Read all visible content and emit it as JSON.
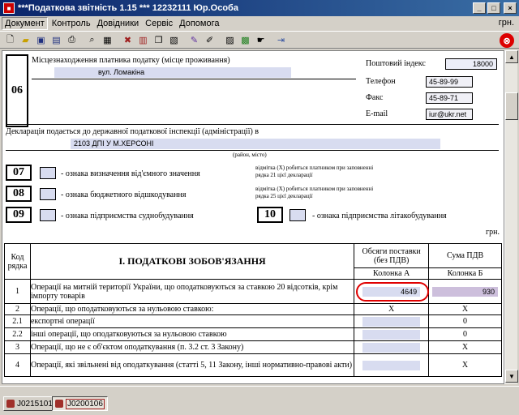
{
  "window": {
    "title": "***Податкова звітність 1.15 *** 12232111 Юр.Особа"
  },
  "menu": {
    "items": [
      "Документ",
      "Контроль",
      "Довідники",
      "Сервіс",
      "Допомога"
    ],
    "currency": "грн."
  },
  "toolbar": {
    "icons": [
      "new-icon",
      "open-icon",
      "save-icon",
      "save-all-icon",
      "print-icon",
      "print-preview-icon",
      "report-icon",
      "delete-icon",
      "books-icon",
      "copy-icon",
      "paste-icon",
      "check-icon",
      "edit-icon",
      "calc-icon",
      "form-icon",
      "lookup-icon",
      "export-icon",
      "exit-icon"
    ]
  },
  "doc": {
    "section06": {
      "num": "06",
      "label": "Місцезнаходження платника податку (місце проживання)",
      "street": "вул. Ломакіна",
      "postal_label": "Поштовий індекс",
      "postal": "18000",
      "phone_label": "Телефон",
      "phone": "45-89-99",
      "fax_label": "Факс",
      "fax": "45-89-71",
      "email_label": "E-mail",
      "email": "iur@ukr.net"
    },
    "declaration_label": "Декларація подається до державної податкової інспекції (адміністрації) в",
    "inspection": "2103 ДПІ У М.ХЕРСОНІ",
    "district_hint": "(район, місто)",
    "flag07": {
      "num": "07",
      "label": "- ознака визначення від'ємного значення",
      "note": "відмітка (Х) робиться платником при заповненні рядка 21 цієї декларації"
    },
    "flag08": {
      "num": "08",
      "label": "- ознака бюджетного відшкодування",
      "note": "відмітка (Х) робиться платником при заповненні рядка 25 цієї декларації"
    },
    "flag09": {
      "num": "09",
      "label": "- ознака підприємства суднобудування"
    },
    "flag10": {
      "num": "10",
      "label": "- ознака підприємства літакобудування"
    },
    "currency": "грн."
  },
  "table": {
    "h_code": "Код рядка",
    "h_title": "I. ПОДАТКОВІ ЗОБОВ'ЯЗАННЯ",
    "h_a": "Обсяги поставки (без ПДВ)",
    "h_b": "Сума ПДВ",
    "h_a2": "Колонка А",
    "h_b2": "Колонка Б",
    "rows": [
      {
        "code": "1",
        "text": "Операції на митній території України, що оподатковуються за ставкою 20 відсотків, крім імпорту товарів",
        "a": "4649",
        "b": "930"
      },
      {
        "code": "2",
        "text": "Операції, що оподатковуються за нульовою ставкою:",
        "a": "X",
        "b": "X"
      },
      {
        "code": "2.1",
        "text": "експортні операції",
        "a": "",
        "b": "0"
      },
      {
        "code": "2.2",
        "text": "інші операції, що оподатковуються за нульовою ставкою",
        "a": "",
        "b": "0"
      },
      {
        "code": "3",
        "text": "Операції, що не є об'єктом оподаткування (п. 3.2 ст. 3 Закону)",
        "a": "",
        "b": "X"
      },
      {
        "code": "4",
        "text": "Операції, які звільнені від оподаткування (статті 5, 11 Закону, інші нормативно-правові акти)",
        "a": "",
        "b": "X"
      }
    ]
  },
  "status": {
    "tab1": "J0215101*",
    "tab2": "J0200106"
  }
}
